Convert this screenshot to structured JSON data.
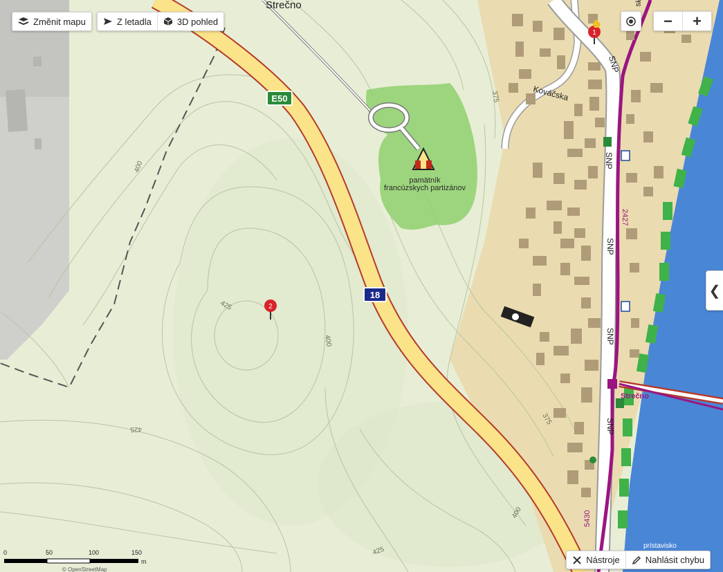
{
  "toolbar": {
    "change_map_label": "Změnit mapu",
    "aerial_label": "Z letadla",
    "view3d_label": "3D pohled"
  },
  "zoom": {
    "minus": "−",
    "plus": "+"
  },
  "side_toggle": "❮",
  "bottom": {
    "tools_label": "Nástroje",
    "report_label": "Nahlásit chybu"
  },
  "scale": {
    "labels": [
      "0",
      "50",
      "100",
      "150",
      "m"
    ]
  },
  "attribution": "© OpenStreetMap",
  "map_labels": {
    "town": "Strečno",
    "road_e50": "E50",
    "road_18": "18",
    "street_kovacska": "Kováčska",
    "street_snp_1": "SNP",
    "street_snp_2": "SNP",
    "street_snp_3": "SNP",
    "street_snp_4": "SNP",
    "street_snp_5": "SNP",
    "road_2427": "2427",
    "road_5430": "5430",
    "station_strecno": "Strečno",
    "poi_memorial_line1": "pamätník",
    "poi_memorial_line2": "francúzskych partizánov",
    "contour_400_a": "400",
    "contour_400_b": "400",
    "contour_425_a": "425",
    "contour_425_b": "425",
    "contour_425_c": "425",
    "contour_375_a": "375",
    "contour_375_b": "375",
    "contour_400_c": "400",
    "pier_label": "prístavisko",
    "partial_top": "ská"
  },
  "markers": {
    "m1": "1",
    "m2": "2"
  },
  "colors": {
    "forest_light": "#e6edd4",
    "road_yellow": "#fbe38a",
    "road_border": "#b53a2a",
    "river": "#4a86d6",
    "river_bank": "#3fb24a",
    "park_green": "#8fd06e",
    "village": "#eadcb0",
    "building": "#b09c78",
    "purple_route": "#9b1580",
    "marker_red": "#d9222a"
  }
}
